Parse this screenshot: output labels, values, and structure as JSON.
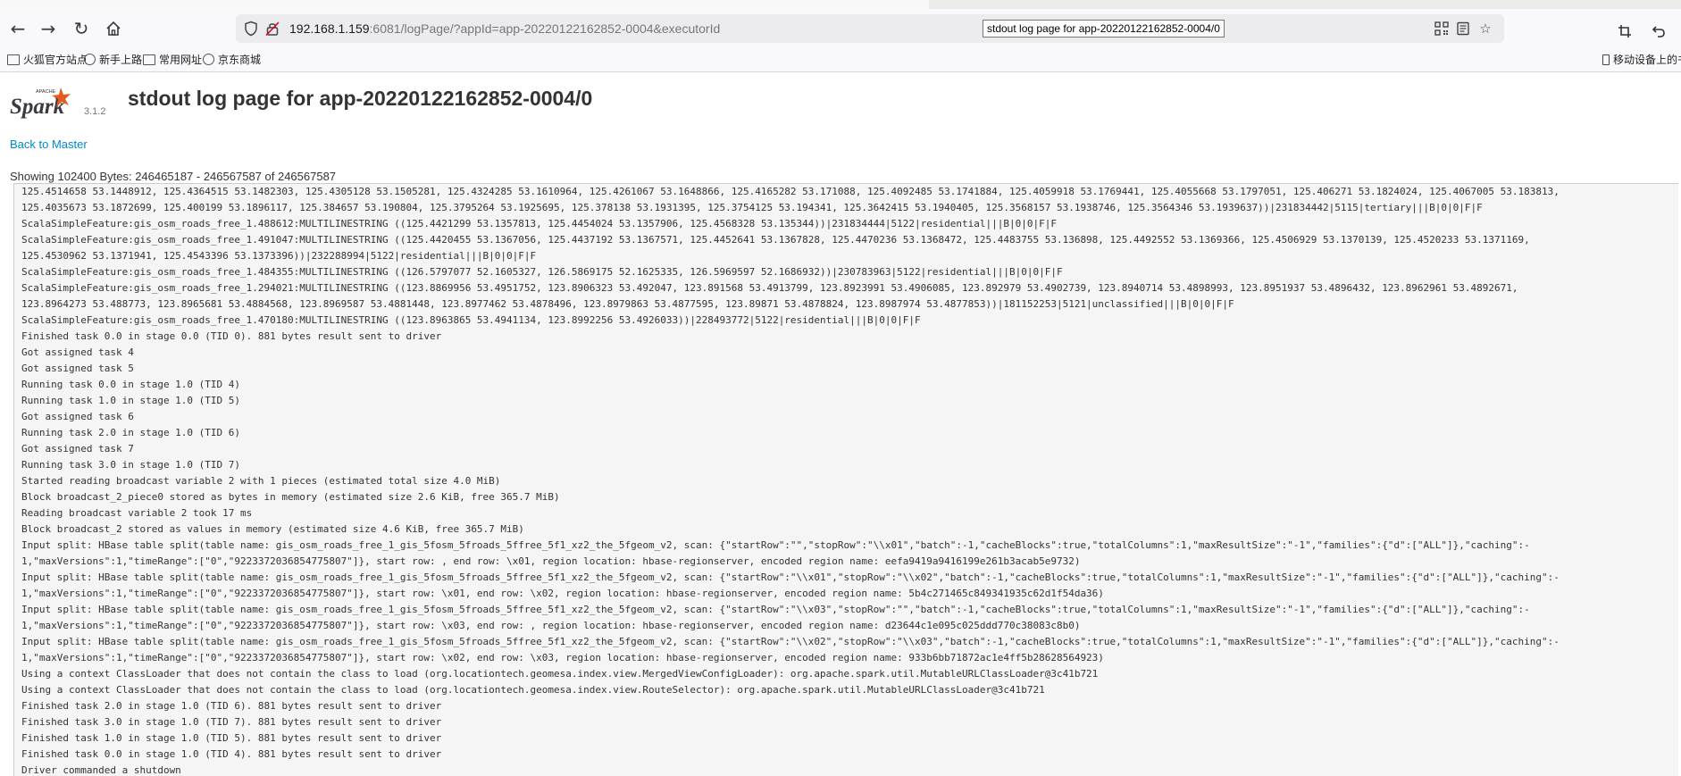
{
  "browser": {
    "url_host": "192.168.1.159",
    "url_rest": ":6081/logPage/?appId=app-20220122162852-0004&executorId",
    "tooltip": "stdout log page for app-20220122162852-0004/0",
    "bookmarks": [
      "火狐官方站点",
      "新手上路",
      "常用网址",
      "京东商城"
    ],
    "mobile_bookmarks": "移动设备上的书签"
  },
  "header": {
    "version": "3.1.2",
    "title": "stdout log page for app-20220122162852-0004/0",
    "logo_small": "APACHE",
    "logo_word": "Spark"
  },
  "back_link": "Back to Master",
  "showing": "Showing 102400 Bytes: 246465187 - 246567587 of 246567587",
  "log_lines": [
    "125.4514658 53.1448912, 125.4364515 53.1482303, 125.4305128 53.1505281, 125.4324285 53.1610964, 125.4261067 53.1648866, 125.4165282 53.171088, 125.4092485 53.1741884, 125.4059918 53.1769441, 125.4055668 53.1797051, 125.406271 53.1824024, 125.4067005 53.183813,",
    "125.4035673 53.1872699, 125.400199 53.1896117, 125.384657 53.190804, 125.3795264 53.1925695, 125.378138 53.1931395, 125.3754125 53.194341, 125.3642415 53.1940405, 125.3568157 53.1938746, 125.3564346 53.1939637))|231834442|5115|tertiary|||B|0|0|F|F",
    "ScalaSimpleFeature:gis_osm_roads_free_1.488612:MULTILINESTRING ((125.4421299 53.1357813, 125.4454024 53.1357906, 125.4568328 53.135344))|231834444|5122|residential|||B|0|0|F|F",
    "ScalaSimpleFeature:gis_osm_roads_free_1.491047:MULTILINESTRING ((125.4420455 53.1367056, 125.4437192 53.1367571, 125.4452641 53.1367828, 125.4470236 53.1368472, 125.4483755 53.136898, 125.4492552 53.1369366, 125.4506929 53.1370139, 125.4520233 53.1371169,",
    "125.4530962 53.1371941, 125.4543396 53.1373396))|232288994|5122|residential|||B|0|0|F|F",
    "ScalaSimpleFeature:gis_osm_roads_free_1.484355:MULTILINESTRING ((126.5797077 52.1605327, 126.5869175 52.1625335, 126.5969597 52.1686932))|230783963|5122|residential|||B|0|0|F|F",
    "ScalaSimpleFeature:gis_osm_roads_free_1.294021:MULTILINESTRING ((123.8869956 53.4951752, 123.8906323 53.492047, 123.891568 53.4913799, 123.8923991 53.4906085, 123.892979 53.4902739, 123.8940714 53.4898993, 123.8951937 53.4896432, 123.8962961 53.4892671,",
    "123.8964273 53.488773, 123.8965681 53.4884568, 123.8969587 53.4881448, 123.8977462 53.4878496, 123.8979863 53.4877595, 123.89871 53.4878824, 123.8987974 53.4877853))|181152253|5121|unclassified|||B|0|0|F|F",
    "ScalaSimpleFeature:gis_osm_roads_free_1.470180:MULTILINESTRING ((123.8963865 53.4941134, 123.8992256 53.4926033))|228493772|5122|residential|||B|0|0|F|F",
    "Finished task 0.0 in stage 0.0 (TID 0). 881 bytes result sent to driver",
    "Got assigned task 4",
    "Got assigned task 5",
    "Running task 0.0 in stage 1.0 (TID 4)",
    "Running task 1.0 in stage 1.0 (TID 5)",
    "Got assigned task 6",
    "Running task 2.0 in stage 1.0 (TID 6)",
    "Got assigned task 7",
    "Running task 3.0 in stage 1.0 (TID 7)",
    "Started reading broadcast variable 2 with 1 pieces (estimated total size 4.0 MiB)",
    "Block broadcast_2_piece0 stored as bytes in memory (estimated size 2.6 KiB, free 365.7 MiB)",
    "Reading broadcast variable 2 took 17 ms",
    "Block broadcast_2 stored as values in memory (estimated size 4.6 KiB, free 365.7 MiB)",
    "Input split: HBase table split(table name: gis_osm_roads_free_1_gis_5fosm_5froads_5ffree_5f1_xz2_the_5fgeom_v2, scan: {\"startRow\":\"\",\"stopRow\":\"\\\\x01\",\"batch\":-1,\"cacheBlocks\":true,\"totalColumns\":1,\"maxResultSize\":\"-1\",\"families\":{\"d\":[\"ALL\"]},\"caching\":-",
    "1,\"maxVersions\":1,\"timeRange\":[\"0\",\"9223372036854775807\"]}, start row: , end row: \\x01, region location: hbase-regionserver, encoded region name: eefa9419a9416199e261b3acab5e9732)",
    "Input split: HBase table split(table name: gis_osm_roads_free_1_gis_5fosm_5froads_5ffree_5f1_xz2_the_5fgeom_v2, scan: {\"startRow\":\"\\\\x01\",\"stopRow\":\"\\\\x02\",\"batch\":-1,\"cacheBlocks\":true,\"totalColumns\":1,\"maxResultSize\":\"-1\",\"families\":{\"d\":[\"ALL\"]},\"caching\":-",
    "1,\"maxVersions\":1,\"timeRange\":[\"0\",\"9223372036854775807\"]}, start row: \\x01, end row: \\x02, region location: hbase-regionserver, encoded region name: 5b4c271465c849341935c62d1f54da36)",
    "Input split: HBase table split(table name: gis_osm_roads_free_1_gis_5fosm_5froads_5ffree_5f1_xz2_the_5fgeom_v2, scan: {\"startRow\":\"\\\\x03\",\"stopRow\":\"\",\"batch\":-1,\"cacheBlocks\":true,\"totalColumns\":1,\"maxResultSize\":\"-1\",\"families\":{\"d\":[\"ALL\"]},\"caching\":-",
    "1,\"maxVersions\":1,\"timeRange\":[\"0\",\"9223372036854775807\"]}, start row: \\x03, end row: , region location: hbase-regionserver, encoded region name: d23644c1e095c025ddd770c38083c8b0)",
    "Input split: HBase table split(table name: gis_osm_roads_free_1_gis_5fosm_5froads_5ffree_5f1_xz2_the_5fgeom_v2, scan: {\"startRow\":\"\\\\x02\",\"stopRow\":\"\\\\x03\",\"batch\":-1,\"cacheBlocks\":true,\"totalColumns\":1,\"maxResultSize\":\"-1\",\"families\":{\"d\":[\"ALL\"]},\"caching\":-",
    "1,\"maxVersions\":1,\"timeRange\":[\"0\",\"9223372036854775807\"]}, start row: \\x02, end row: \\x03, region location: hbase-regionserver, encoded region name: 933b6bb71872ac1e4ff5b28628564923)",
    "Using a context ClassLoader that does not contain the class to load (org.locationtech.geomesa.index.view.MergedViewConfigLoader): org.apache.spark.util.MutableURLClassLoader@3c41b721",
    "Using a context ClassLoader that does not contain the class to load (org.locationtech.geomesa.index.view.RouteSelector): org.apache.spark.util.MutableURLClassLoader@3c41b721",
    "Finished task 2.0 in stage 1.0 (TID 6). 881 bytes result sent to driver",
    "Finished task 3.0 in stage 1.0 (TID 7). 881 bytes result sent to driver",
    "Finished task 1.0 in stage 1.0 (TID 5). 881 bytes result sent to driver",
    "Finished task 0.0 in stage 1.0 (TID 4). 881 bytes result sent to driver",
    "Driver commanded a shutdown"
  ]
}
